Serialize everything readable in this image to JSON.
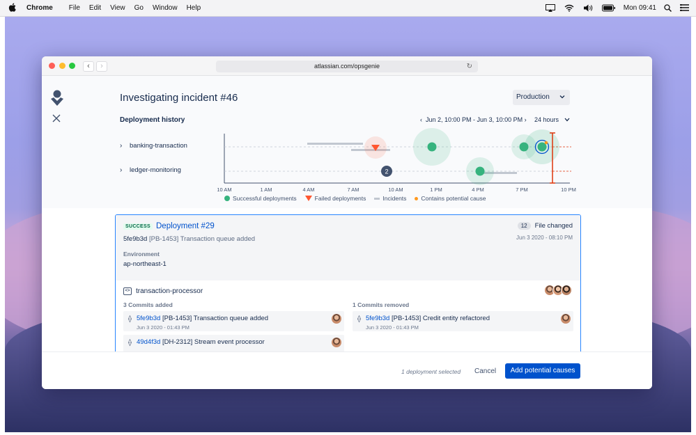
{
  "menubar": {
    "app": "Chrome",
    "menus": [
      "File",
      "Edit",
      "View",
      "Go",
      "Window",
      "Help"
    ],
    "clock": "Mon 09:41"
  },
  "browser": {
    "url": "atlassian.com/opsgenie"
  },
  "page": {
    "title": "Investigating incident #46",
    "environment_select": "Production",
    "deployment_history_label": "Deployment history",
    "time_range": "Jun 2, 10:00 PM - Jun 3, 10:00 PM",
    "time_span_select": "24 hours",
    "services": [
      "banking-transaction",
      "ledger-monitoring"
    ],
    "axis_ticks": [
      "10 AM",
      "1 AM",
      "4 AM",
      "7 AM",
      "10 AM",
      "1 PM",
      "4 PM",
      "7 PM",
      "10 PM"
    ],
    "grouped_count": "2",
    "legend": {
      "successful": "Successful deployments",
      "failed": "Failed deployments",
      "incidents": "Incidents",
      "potential_cause": "Contains potential cause"
    },
    "colors": {
      "success": "#36b37e",
      "failed": "#ff5630",
      "incident": "#c1c7d0",
      "potential_cause": "#ff991f",
      "selected": "#0052cc",
      "now_marker": "#de350b"
    }
  },
  "deployment": {
    "status_badge": "SUCCESS",
    "title": "Deployment #29",
    "commit_hash": "5fe9b3d",
    "commit_message": "[PB-1453] Transaction queue added",
    "files_changed_count": "12",
    "files_changed_label": "File changed",
    "date": "Jun 3 2020 - 08:10 PM",
    "environment_label": "Environment",
    "environment_value": "ap-northeast-1",
    "repository": "transaction-processor",
    "commits_added_label": "3 Commits added",
    "commits_removed_label": "1 Commits removed",
    "commits_added": [
      {
        "hash": "5fe9b3d",
        "message": "[PB-1453] Transaction queue added",
        "date": "Jun 3 2020 - 01:43 PM"
      },
      {
        "hash": "49d4f3d",
        "message": "[DH-2312] Stream event processor",
        "date": ""
      }
    ],
    "commits_removed": [
      {
        "hash": "5fe9b3d",
        "message": "[PB-1453] Credit entity refactored",
        "date": "Jun 3 2020 - 01:43 PM"
      }
    ]
  },
  "footer": {
    "selection_text": "1 deployment selected",
    "cancel_label": "Cancel",
    "primary_label": "Add potential causes"
  }
}
